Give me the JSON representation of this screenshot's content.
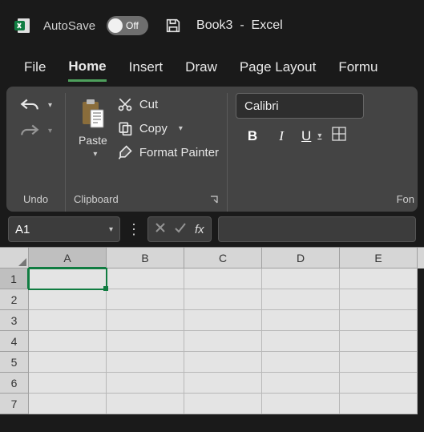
{
  "titlebar": {
    "autosave_label": "AutoSave",
    "toggle_state": "Off",
    "document": "Book3",
    "separator": "-",
    "app": "Excel"
  },
  "tabs": [
    "File",
    "Home",
    "Insert",
    "Draw",
    "Page Layout",
    "Formu"
  ],
  "active_tab": "Home",
  "ribbon": {
    "undo_group_label": "Undo",
    "paste_label": "Paste",
    "cut_label": "Cut",
    "copy_label": "Copy",
    "format_painter_label": "Format Painter",
    "clipboard_group_label": "Clipboard",
    "font_name": "Calibri",
    "font_group_label": "Fon",
    "bold": "B",
    "italic": "I",
    "underline": "U"
  },
  "namebox": "A1",
  "fx": "fx",
  "columns": [
    "A",
    "B",
    "C",
    "D",
    "E"
  ],
  "rows": [
    "1",
    "2",
    "3",
    "4",
    "5",
    "6",
    "7"
  ],
  "selected_col": "A",
  "selected_row": "1"
}
